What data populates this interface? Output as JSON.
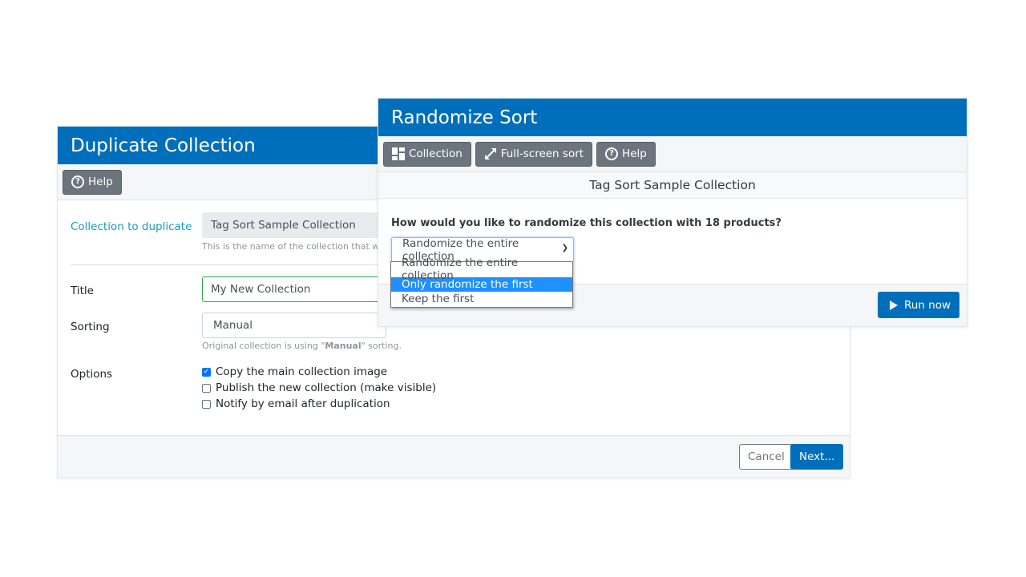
{
  "duplicate_panel": {
    "title": "Duplicate Collection",
    "help_button": {
      "label": "Help",
      "icon": "question-circle-icon"
    },
    "collection_to_duplicate": {
      "label": "Collection to duplicate",
      "value": "Tag Sort Sample Collection",
      "help": "This is the name of the collection that will"
    },
    "title_field": {
      "label": "Title",
      "value": "My New Collection"
    },
    "sorting_field": {
      "label": "Sorting",
      "value": "Manual",
      "help_prefix": "Original collection is using \"",
      "help_strong": "Manual",
      "help_suffix": "\" sorting."
    },
    "options": {
      "label": "Options",
      "items": [
        {
          "label": "Copy the main collection image",
          "checked": true
        },
        {
          "label": "Publish the new collection (make visible)",
          "checked": false
        },
        {
          "label": "Notify by email after duplication",
          "checked": false
        }
      ]
    },
    "cancel_label": "Cancel",
    "next_label": "Next..."
  },
  "randomize_panel": {
    "title": "Randomize Sort",
    "toolbar": [
      {
        "label": "Collection",
        "icon": "grid-icon"
      },
      {
        "label": "Full-screen sort",
        "icon": "expand-arrows-icon"
      },
      {
        "label": "Help",
        "icon": "question-circle-icon"
      }
    ],
    "collection_name": "Tag Sort Sample Collection",
    "question": "How would you like to randomize this collection with 18 products?",
    "select_value": "Randomize the entire collection",
    "select_options": [
      {
        "label": "Randomize the entire collection",
        "highlighted": false
      },
      {
        "label": "Only randomize the first",
        "highlighted": true
      },
      {
        "label": "Keep the first",
        "highlighted": false
      }
    ],
    "run_label": "Run now"
  },
  "colors": {
    "header_blue": "#006fbb",
    "teal_label": "#1a9ac0",
    "option_highlight": "#1e90ff",
    "button_gray": "#6c757d"
  }
}
